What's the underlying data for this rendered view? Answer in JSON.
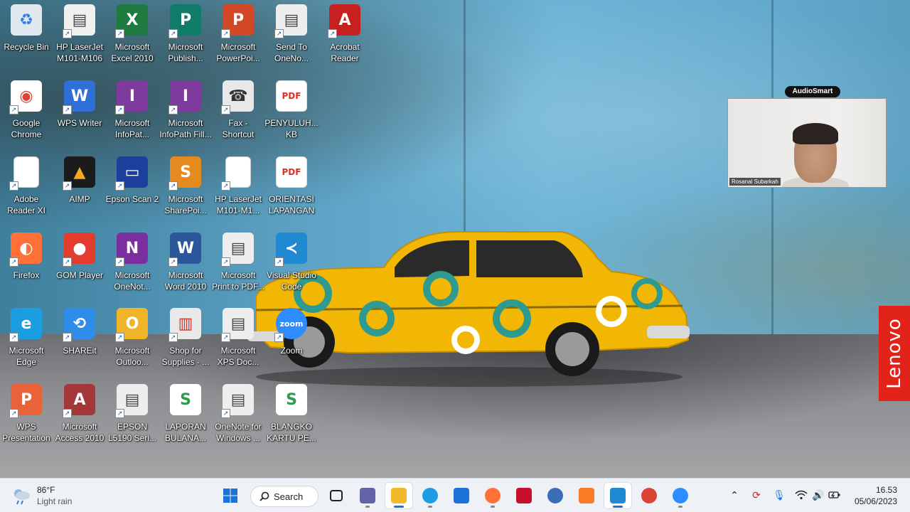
{
  "desktop": {
    "icons": [
      {
        "label": "Recycle Bin",
        "icon": "recycle-bin-icon",
        "color": "#dfe8ee",
        "fg": "#3a7bd5",
        "glyph": "♻",
        "shortcut": false
      },
      {
        "label": "HP LaserJet\nM101-M106",
        "icon": "printer-icon",
        "color": "#f0f0f0",
        "fg": "#444",
        "glyph": "▤",
        "shortcut": true
      },
      {
        "label": "Microsoft\nExcel 2010",
        "icon": "excel-icon",
        "color": "#1f7a3f",
        "fg": "#fff",
        "glyph": "X",
        "shortcut": true
      },
      {
        "label": "Microsoft\nPublish...",
        "icon": "publisher-icon",
        "color": "#0f7b68",
        "fg": "#fff",
        "glyph": "P",
        "shortcut": true
      },
      {
        "label": "Microsoft\nPowerPoi...",
        "icon": "powerpoint-icon",
        "color": "#d24726",
        "fg": "#fff",
        "glyph": "P",
        "shortcut": true
      },
      {
        "label": "Send To\nOneNo...",
        "icon": "printer-icon",
        "color": "#eeeeee",
        "fg": "#444",
        "glyph": "▤",
        "shortcut": true
      },
      {
        "label": "Acrobat\nReader",
        "icon": "acrobat-icon",
        "color": "#c8201e",
        "fg": "#fff",
        "glyph": "A",
        "shortcut": true
      },
      {
        "label": "Google\nChrome",
        "icon": "chrome-icon",
        "color": "#ffffff",
        "fg": "#db4437",
        "glyph": "◉",
        "shortcut": true
      },
      {
        "label": "WPS Writer",
        "icon": "wps-writer-icon",
        "color": "#2f6fd8",
        "fg": "#fff",
        "glyph": "W",
        "shortcut": true
      },
      {
        "label": "Microsoft\nInfoPat...",
        "icon": "infopath-icon",
        "color": "#7e3a9c",
        "fg": "#fff",
        "glyph": "I",
        "shortcut": true
      },
      {
        "label": "Microsoft\nInfoPath Fill...",
        "icon": "infopath-icon",
        "color": "#7e3a9c",
        "fg": "#fff",
        "glyph": "I",
        "shortcut": true
      },
      {
        "label": "Fax -\nShortcut",
        "icon": "fax-icon",
        "color": "#e8e8e8",
        "fg": "#333",
        "glyph": "☎",
        "shortcut": true
      },
      {
        "label": "PENYULUH...\nKB",
        "icon": "pdf-icon",
        "color": "#ffffff",
        "fg": "#d93025",
        "glyph": "PDF",
        "shortcut": false
      },
      {
        "label": "Adobe\nReader XI",
        "icon": "document-icon",
        "color": "#ffffff",
        "fg": "#999",
        "glyph": "",
        "shortcut": true
      },
      {
        "label": "AIMP",
        "icon": "aimp-icon",
        "color": "#1b1b1b",
        "fg": "#f5a623",
        "glyph": "▲",
        "shortcut": true
      },
      {
        "label": "Epson Scan 2",
        "icon": "scanner-icon",
        "color": "#1c3f9c",
        "fg": "#fff",
        "glyph": "▭",
        "shortcut": true
      },
      {
        "label": "Microsoft\nSharePoi...",
        "icon": "sharepoint-icon",
        "color": "#e58a1f",
        "fg": "#fff",
        "glyph": "S",
        "shortcut": true
      },
      {
        "label": "HP LaserJet\nM101-M1...",
        "icon": "document-icon",
        "color": "#ffffff",
        "fg": "#999",
        "glyph": "",
        "shortcut": true
      },
      {
        "label": "ORIENTASI\nLAPANGAN",
        "icon": "pdf-icon",
        "color": "#ffffff",
        "fg": "#d93025",
        "glyph": "PDF",
        "shortcut": false
      },
      {
        "label": "Firefox",
        "icon": "firefox-icon",
        "color": "#ff7139",
        "fg": "#fff",
        "glyph": "◐",
        "shortcut": true
      },
      {
        "label": "GOM Player",
        "icon": "gom-player-icon",
        "color": "#e33b2e",
        "fg": "#fff",
        "glyph": "●",
        "shortcut": true
      },
      {
        "label": "Microsoft\nOneNot...",
        "icon": "onenote-icon",
        "color": "#7b2f9e",
        "fg": "#fff",
        "glyph": "N",
        "shortcut": true
      },
      {
        "label": "Microsoft\nWord 2010",
        "icon": "word-icon",
        "color": "#2b579a",
        "fg": "#fff",
        "glyph": "W",
        "shortcut": true
      },
      {
        "label": "Microsoft\nPrint to PDF...",
        "icon": "printer-icon",
        "color": "#eeeeee",
        "fg": "#444",
        "glyph": "▤",
        "shortcut": true
      },
      {
        "label": "Visual Studio\nCode",
        "icon": "vscode-icon",
        "color": "#1f8ad2",
        "fg": "#fff",
        "glyph": "≺",
        "shortcut": true
      },
      {
        "label": "Microsoft\nEdge",
        "icon": "edge-icon",
        "color": "#1b9de2",
        "fg": "#fff",
        "glyph": "e",
        "shortcut": true
      },
      {
        "label": "SHAREit",
        "icon": "shareit-icon",
        "color": "#2f8ce8",
        "fg": "#fff",
        "glyph": "⟲",
        "shortcut": true
      },
      {
        "label": "Microsoft\nOutloo...",
        "icon": "outlook-icon",
        "color": "#f0b429",
        "fg": "#fff",
        "glyph": "O",
        "shortcut": true
      },
      {
        "label": "Shop for\nSupplies - ...",
        "icon": "shop-supplies-icon",
        "color": "#e9e9e9",
        "fg": "#c33",
        "glyph": "▥",
        "shortcut": true
      },
      {
        "label": "Microsoft\nXPS Doc...",
        "icon": "printer-icon",
        "color": "#eeeeee",
        "fg": "#444",
        "glyph": "▤",
        "shortcut": true
      },
      {
        "label": "Zoom",
        "icon": "zoom-icon",
        "color": "#2d8cff",
        "fg": "#fff",
        "glyph": "zoom",
        "shortcut": true
      },
      {
        "label": "WPS\nPresentation",
        "icon": "wps-presentation-icon",
        "color": "#e8623a",
        "fg": "#fff",
        "glyph": "P",
        "shortcut": true
      },
      {
        "label": "Microsoft\nAccess 2010",
        "icon": "access-icon",
        "color": "#a4373a",
        "fg": "#fff",
        "glyph": "A",
        "shortcut": true
      },
      {
        "label": "EPSON\nL5190 Seri...",
        "icon": "printer-icon",
        "color": "#eeeeee",
        "fg": "#444",
        "glyph": "▤",
        "shortcut": true
      },
      {
        "label": "LAPORAN\nBULANA...",
        "icon": "spreadsheet-icon",
        "color": "#ffffff",
        "fg": "#2e9b4f",
        "glyph": "S",
        "shortcut": false
      },
      {
        "label": "OneNote for\nWindows ...",
        "icon": "printer-icon",
        "color": "#eeeeee",
        "fg": "#444",
        "glyph": "▤",
        "shortcut": true
      },
      {
        "label": "BLANGKO\nKARTU PE...",
        "icon": "spreadsheet-icon",
        "color": "#ffffff",
        "fg": "#2e9b4f",
        "glyph": "S",
        "shortcut": false
      }
    ]
  },
  "zoom_video": {
    "app_badge": "AudioSmart",
    "participant_name": "Rosanal Subarkah"
  },
  "brand": {
    "lenovo": "Lenovo",
    "lenovo_color": "#e2231a"
  },
  "taskbar": {
    "weather": {
      "temp": "86°F",
      "condition": "Light rain",
      "icon": "cloud-rain-icon"
    },
    "search_label": "Search",
    "apps": [
      {
        "name": "start-button",
        "icon": "windows-icon",
        "color": "#1a73d8"
      },
      {
        "name": "task-view-button",
        "icon": "task-view-icon",
        "color": "#222"
      },
      {
        "name": "teams-chat-button",
        "icon": "teams-icon",
        "color": "#6264a7"
      },
      {
        "name": "file-explorer-button",
        "icon": "folder-icon",
        "color": "#f2b92b",
        "active": true
      },
      {
        "name": "edge-button",
        "icon": "edge-icon",
        "color": "#1b9de2"
      },
      {
        "name": "mail-button",
        "icon": "mail-icon",
        "color": "#1a73d8"
      },
      {
        "name": "firefox-button",
        "icon": "firefox-icon",
        "color": "#ff7139"
      },
      {
        "name": "mcafee-button",
        "icon": "mcafee-icon",
        "color": "#c8102e"
      },
      {
        "name": "media-button",
        "icon": "globe-icon",
        "color": "#3b6fb5"
      },
      {
        "name": "xampp-button",
        "icon": "xampp-icon",
        "color": "#fb7a24"
      },
      {
        "name": "vscode-button",
        "icon": "vscode-icon",
        "color": "#1f8ad2",
        "active": true
      },
      {
        "name": "chrome-button",
        "icon": "chrome-icon",
        "color": "#db4437"
      },
      {
        "name": "zoom-button",
        "icon": "zoom-icon",
        "color": "#2d8cff"
      }
    ],
    "clock": {
      "time": "16.53",
      "date": "05/06/2023"
    }
  }
}
